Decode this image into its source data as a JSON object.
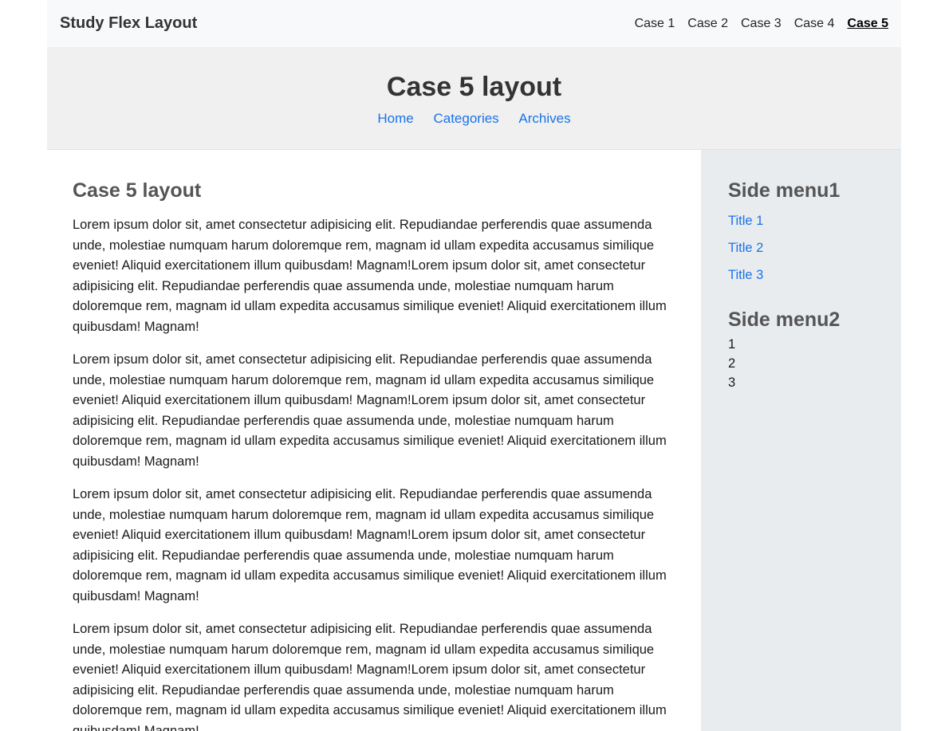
{
  "topbar": {
    "brand": "Study Flex Layout",
    "nav": [
      "Case 1",
      "Case 2",
      "Case 3",
      "Case 4",
      "Case 5"
    ]
  },
  "hero": {
    "title": "Case 5 layout",
    "links": [
      "Home",
      "Categories",
      "Archives"
    ]
  },
  "main": {
    "title": "Case 5 layout",
    "paragraphs": [
      "Lorem ipsum dolor sit, amet consectetur adipisicing elit. Repudiandae perferendis quae assumenda unde, molestiae numquam harum doloremque rem, magnam id ullam expedita accusamus similique eveniet! Aliquid exercitationem illum quibusdam! Magnam!Lorem ipsum dolor sit, amet consectetur adipisicing elit. Repudiandae perferendis quae assumenda unde, molestiae numquam harum doloremque rem, magnam id ullam expedita accusamus similique eveniet! Aliquid exercitationem illum quibusdam! Magnam!",
      "Lorem ipsum dolor sit, amet consectetur adipisicing elit. Repudiandae perferendis quae assumenda unde, molestiae numquam harum doloremque rem, magnam id ullam expedita accusamus similique eveniet! Aliquid exercitationem illum quibusdam! Magnam!Lorem ipsum dolor sit, amet consectetur adipisicing elit. Repudiandae perferendis quae assumenda unde, molestiae numquam harum doloremque rem, magnam id ullam expedita accusamus similique eveniet! Aliquid exercitationem illum quibusdam! Magnam!",
      "Lorem ipsum dolor sit, amet consectetur adipisicing elit. Repudiandae perferendis quae assumenda unde, molestiae numquam harum doloremque rem, magnam id ullam expedita accusamus similique eveniet! Aliquid exercitationem illum quibusdam! Magnam!Lorem ipsum dolor sit, amet consectetur adipisicing elit. Repudiandae perferendis quae assumenda unde, molestiae numquam harum doloremque rem, magnam id ullam expedita accusamus similique eveniet! Aliquid exercitationem illum quibusdam! Magnam!",
      "Lorem ipsum dolor sit, amet consectetur adipisicing elit. Repudiandae perferendis quae assumenda unde, molestiae numquam harum doloremque rem, magnam id ullam expedita accusamus similique eveniet! Aliquid exercitationem illum quibusdam! Magnam!Lorem ipsum dolor sit, amet consectetur adipisicing elit. Repudiandae perferendis quae assumenda unde, molestiae numquam harum doloremque rem, magnam id ullam expedita accusamus similique eveniet! Aliquid exercitationem illum quibusdam! Magnam!"
    ]
  },
  "side": {
    "menu1_title": "Side menu1",
    "menu1_links": [
      "Title 1",
      "Title 2",
      "Title 3"
    ],
    "menu2_title": "Side menu2",
    "menu2_items": [
      "1",
      "2",
      "3"
    ]
  },
  "colors": {
    "link": "#1a73e8",
    "topbar_bg": "#f8f9fa",
    "hero_bg": "#f0f0f0",
    "sidebar_bg": "#e9ecef"
  }
}
